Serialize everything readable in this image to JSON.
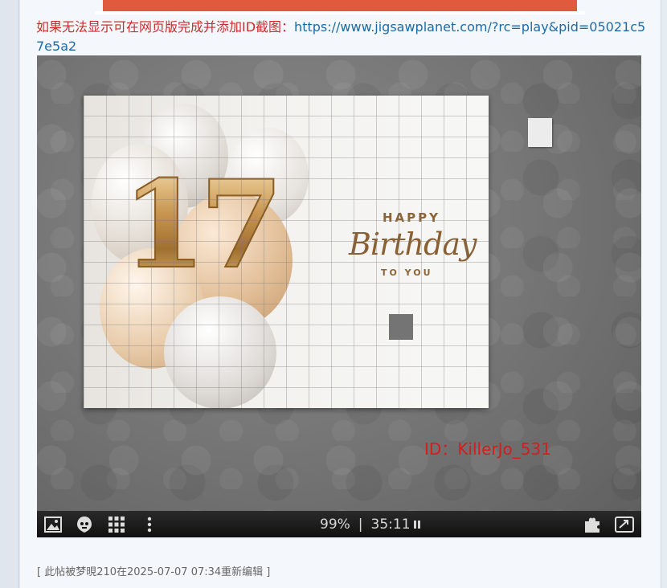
{
  "notice": {
    "text": "如果无法显示可在网页版完成并添加ID截图：",
    "link": "https://www.jigsawplanet.com/?rc=play&pid=05021c57e5a2"
  },
  "puzzle": {
    "number_text": "17",
    "happy_text": "HAPPY",
    "birthday_text": "Birthday",
    "toyou_text": "TO YOU",
    "id_label": "ID：KillerJo_531"
  },
  "toolbar": {
    "progress": "99%",
    "separator": "|",
    "timer": "35:11"
  },
  "edit_note": "[ 此帖被梦晛210在2025-07-07 07:34重新编辑 ]",
  "colors": {
    "notice_red": "#d12a2a",
    "link_blue": "#1b6aa8",
    "id_red": "#d01f1f",
    "banner": "#e05a3e"
  },
  "icons": [
    "image-icon",
    "ghost-icon",
    "grid-icon",
    "more-vertical-icon",
    "puzzle-piece-icon",
    "fullscreen-icon"
  ]
}
